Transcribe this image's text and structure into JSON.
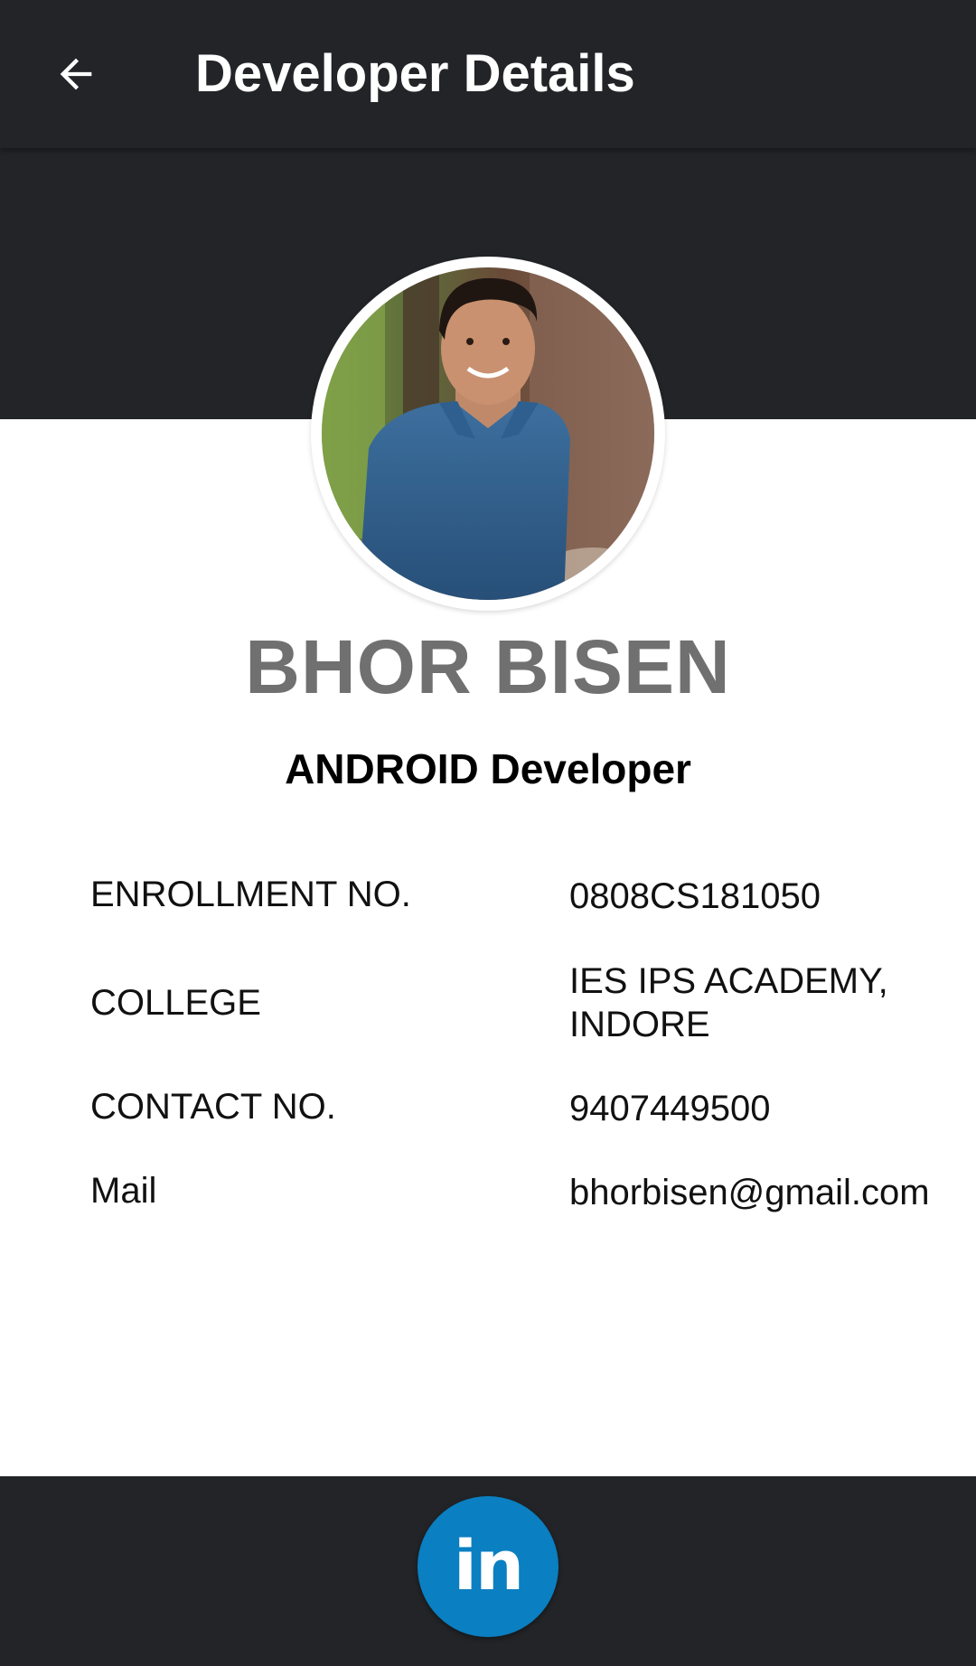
{
  "app_bar": {
    "title": "Developer Details",
    "back_icon": "arrow-back-icon"
  },
  "profile": {
    "name": "BHOR BISEN",
    "role": "ANDROID Developer",
    "photo": "profile-photo"
  },
  "details": [
    {
      "label": "ENROLLMENT NO.",
      "value": "0808CS181050"
    },
    {
      "label": "COLLEGE",
      "value": "IES IPS ACADEMY,\nINDORE"
    },
    {
      "label": "CONTACT NO.",
      "value": "9407449500"
    },
    {
      "label": "Mail",
      "value": "bhorbisen@gmail.com"
    }
  ],
  "footer": {
    "linkedin_text": "in",
    "linkedin_icon": "linkedin-icon"
  },
  "colors": {
    "dark": "#222428",
    "name_gray": "#707070",
    "linkedin_blue": "#0A7FC1"
  }
}
